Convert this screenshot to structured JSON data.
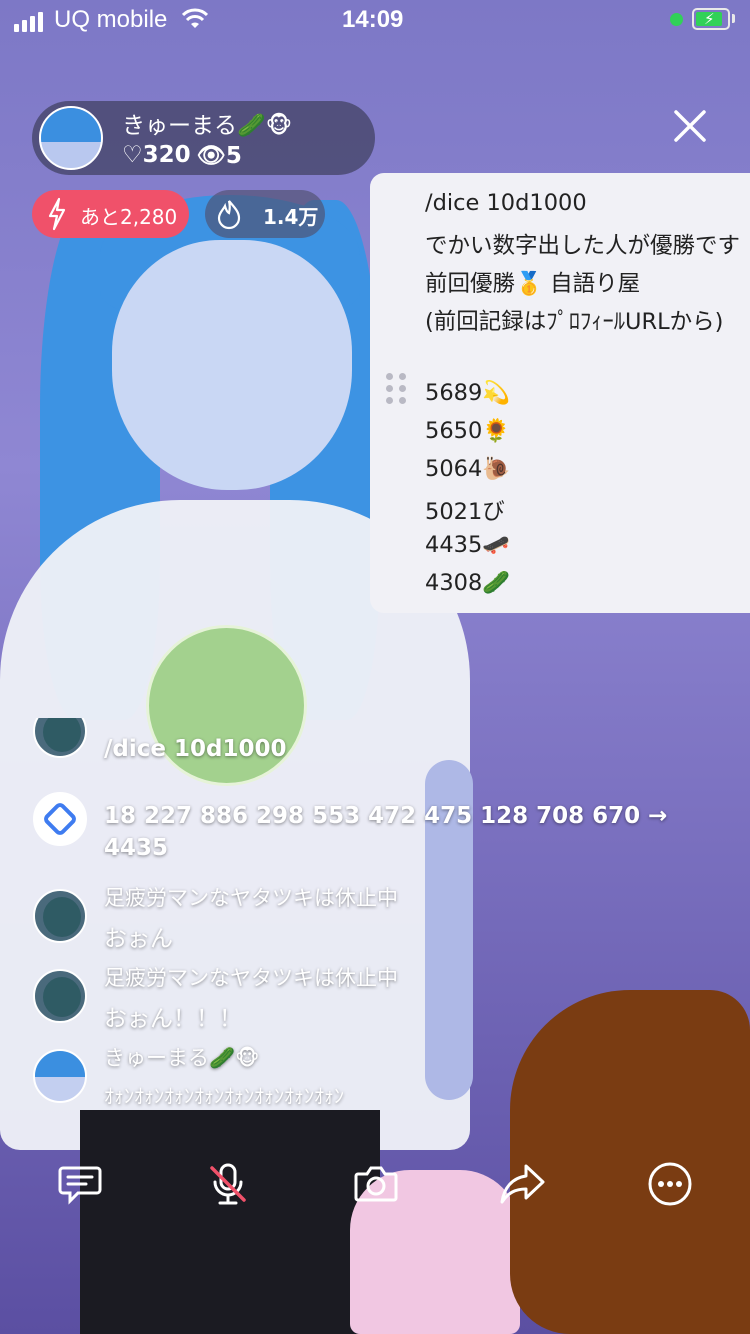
{
  "status_bar": {
    "carrier": "UQ mobile",
    "time": "14:09"
  },
  "host": {
    "name": "きゅーまる🥒🐵",
    "likes": "♡320",
    "viewers": "👁5"
  },
  "pills": {
    "remaining": "あと2,280",
    "points": "1.4万"
  },
  "note": {
    "lines": [
      "/dice 10d1000",
      "でかい数字出した人が優勝です",
      "前回優勝🥇 自語り屋",
      "(前回記録はﾌﾟﾛﾌｨｰﾙURLから)",
      "5689💫",
      "5650🌻",
      "5064🐌",
      "5021び",
      "4435🛹",
      "4308🥒"
    ]
  },
  "chat": {
    "messages": [
      {
        "text": "/dice 10d1000"
      },
      {
        "text_line1": "18 227 886 298 553 472 475 128 708 670 →",
        "text_line2": "4435"
      },
      {
        "name": "足疲労マンなヤタツキは休止中",
        "text": "おぉん"
      },
      {
        "name": "足疲労マンなヤタツキは休止中",
        "text": "おぉん！！！"
      },
      {
        "name": "きゅーまる🥒🐵",
        "text": "ｵｫﾝｵｫﾝｵｫﾝｵｫﾝｵｫﾝｵｫﾝｵｫﾝｵｫﾝ"
      }
    ]
  },
  "toolbar": {
    "icons": [
      "comment-icon",
      "mic-off-icon",
      "camera-icon",
      "share-icon",
      "more-icon"
    ]
  },
  "colors": {
    "accent_red": "#f0516a",
    "battery_green": "#31d158"
  }
}
